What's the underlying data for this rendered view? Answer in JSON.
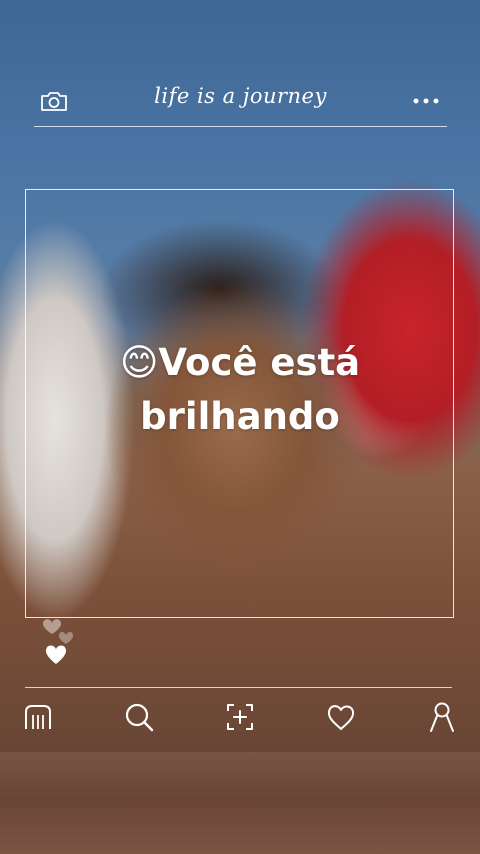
{
  "header": {
    "brand_text": "life is a journey",
    "camera_icon": "camera-icon",
    "menu_icon": "more-dots-icon"
  },
  "post": {
    "caption_emoji": "😊",
    "caption_line1": "Você está",
    "caption_line2": "brilhando"
  },
  "reactions": {
    "icon": "hearts-icon"
  },
  "navbar": {
    "items": [
      {
        "name": "home",
        "icon": "home-icon"
      },
      {
        "name": "search",
        "icon": "search-icon"
      },
      {
        "name": "add",
        "icon": "add-post-icon"
      },
      {
        "name": "likes",
        "icon": "heart-icon"
      },
      {
        "name": "profile",
        "icon": "profile-icon"
      }
    ]
  },
  "colors": {
    "overlay_line": "#ffffff",
    "wall_blue": "#4a74a3",
    "pillow_red": "#c8242b"
  }
}
